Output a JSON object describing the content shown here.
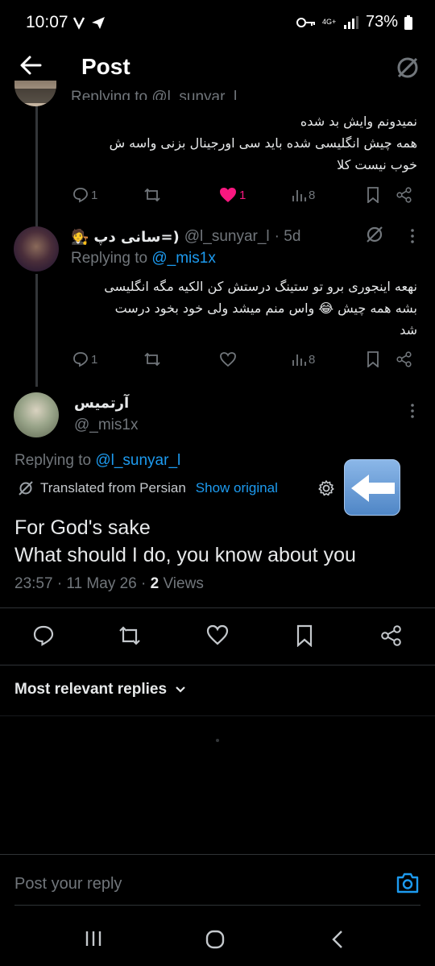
{
  "status": {
    "time": "10:07",
    "battery": "73%",
    "network": "4G+"
  },
  "header": {
    "title": "Post"
  },
  "parent_tweet": {
    "replying_partial": "Replying to @l_sunyar_l",
    "text_lines": [
      "نمیدونم وایش بد شده",
      "همه چیش انگلیسی شده باید سی اورجینال بزنی واسه ش",
      "خوب نیست کلا"
    ],
    "replies": "1",
    "likes": "1",
    "views": "8"
  },
  "reply_tweet": {
    "display_name": "سانی دپ=)",
    "handle": "@l_sunyar_l",
    "time": "· 5d",
    "replying_label": "Replying to ",
    "replying_handle": "@_mis1x",
    "text_lines": [
      "نهعه اینجوری برو تو ستینگ درستش کن الکیه مگه انگلیسی",
      "بشه همه چیش 😂 واس منم میشد ولی خود بخود درست",
      "شد"
    ],
    "replies": "1",
    "views": "8"
  },
  "main_tweet": {
    "display_name": "آرتمیس",
    "handle": "@_mis1x",
    "replying_label": "Replying to ",
    "replying_handle": "@l_sunyar_l",
    "translated_label": "Translated from Persian",
    "show_original": "Show original",
    "text_line1": "For God's sake",
    "text_line2": "What should I do, you know about you",
    "timestamp": "23:57 · 11 May 26 · ",
    "views_count": "2",
    "views_label": " Views"
  },
  "replies_sort": {
    "label": "Most relevant replies"
  },
  "composer": {
    "placeholder": "Post your reply"
  },
  "colors": {
    "accent": "#1d9bf0",
    "like": "#f91880",
    "muted": "#71767b",
    "bg": "#000000"
  }
}
